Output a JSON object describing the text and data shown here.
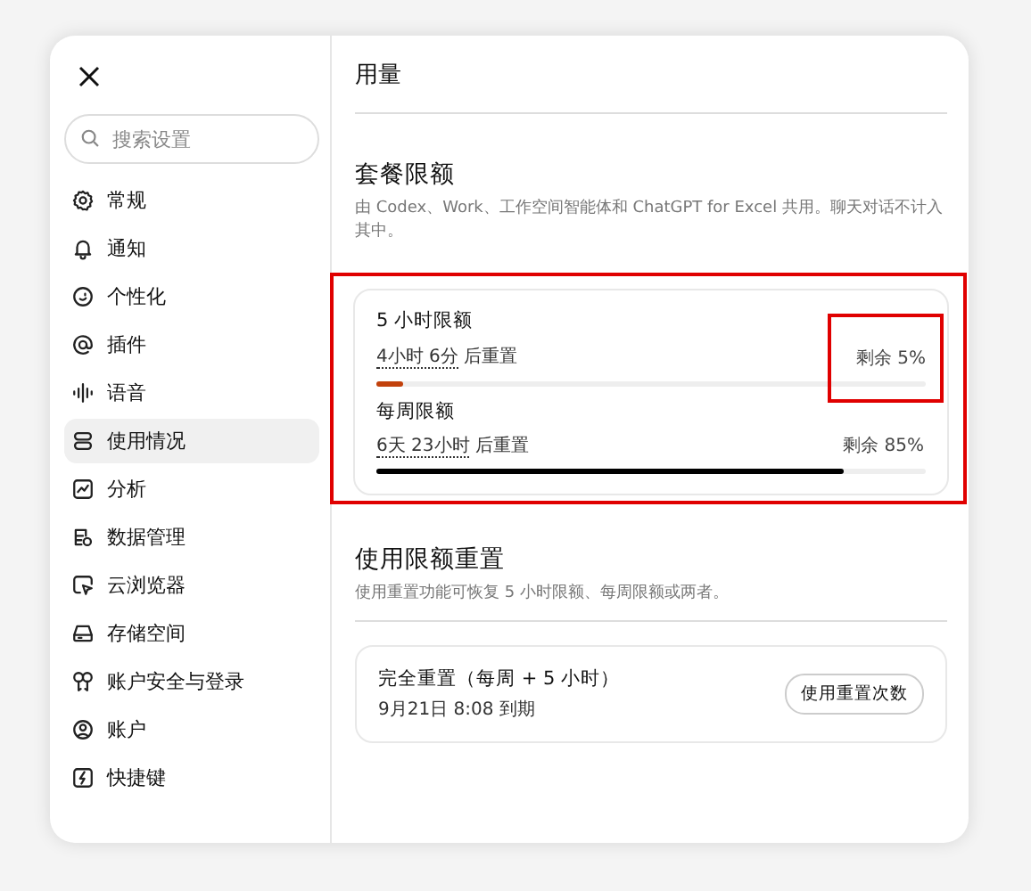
{
  "sidebar": {
    "search": {
      "placeholder": "搜索设置"
    },
    "items": [
      {
        "label": "常规",
        "selected": false
      },
      {
        "label": "通知",
        "selected": false
      },
      {
        "label": "个性化",
        "selected": false
      },
      {
        "label": "插件",
        "selected": false
      },
      {
        "label": "语音",
        "selected": false
      },
      {
        "label": "使用情况",
        "selected": true
      },
      {
        "label": "分析",
        "selected": false
      },
      {
        "label": "数据管理",
        "selected": false
      },
      {
        "label": "云浏览器",
        "selected": false
      },
      {
        "label": "存储空间",
        "selected": false
      },
      {
        "label": "账户安全与登录",
        "selected": false
      },
      {
        "label": "账户",
        "selected": false
      },
      {
        "label": "快捷键",
        "selected": false
      }
    ]
  },
  "page_title": "用量",
  "plan_limits": {
    "title": "套餐限额",
    "description": "由 Codex、Work、工作空间智能体和 ChatGPT for Excel 共用。聊天对话不计入其中。",
    "highlighted": true,
    "limits": [
      {
        "name": "5 小时限额",
        "reset_time": "4小时 6分",
        "reset_suffix": "后重置",
        "remaining": "剩余 5%",
        "level": 0.05,
        "color": "#c2410c",
        "highlighted": true
      },
      {
        "name": "每周限额",
        "reset_time": "6天 23小时",
        "reset_suffix": "后重置",
        "remaining": "剩余 85%",
        "level": 0.85,
        "color": "#000000",
        "highlighted": false
      }
    ]
  },
  "reset_section": {
    "title": "使用限额重置",
    "description": "使用重置功能可恢复 5 小时限额、每周限额或两者。",
    "card": {
      "title": "完全重置（每周 + 5 小时）",
      "subtitle": "9月21日 8:08 到期",
      "button": "使用重置次数"
    }
  }
}
